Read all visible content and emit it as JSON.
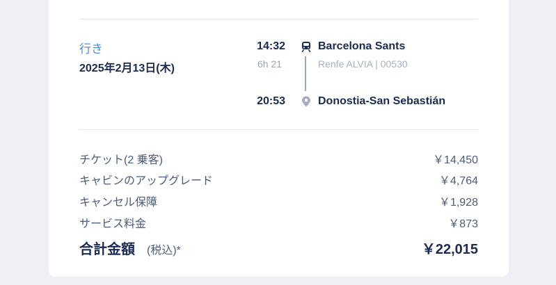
{
  "trip": {
    "direction_label": "行き",
    "date": "2025年2月13日(木)",
    "departure": {
      "time": "14:32",
      "station": "Barcelona Sants"
    },
    "duration": "6h 21",
    "service": "Renfe ALVIA | 00530",
    "arrival": {
      "time": "20:53",
      "station": "Donostia-San Sebastián"
    },
    "icons": [
      "train-icon",
      "location-pin-icon"
    ]
  },
  "price_breakdown": {
    "items": [
      {
        "label": "チケット(2 乗客)",
        "amount": "￥14,450"
      },
      {
        "label": "キャビンのアップグレード",
        "amount": "￥4,764"
      },
      {
        "label": "キャンセル保障",
        "amount": "￥1,928"
      },
      {
        "label": "サービス料金",
        "amount": "￥873"
      }
    ],
    "total": {
      "label": "合計金額",
      "note": "(税込)*",
      "amount": "￥22,015"
    }
  },
  "colors": {
    "accent": "#4a8fd6",
    "text_primary": "#1a2a52",
    "text_muted": "#9aa3b5",
    "background": "#eef0f5"
  }
}
